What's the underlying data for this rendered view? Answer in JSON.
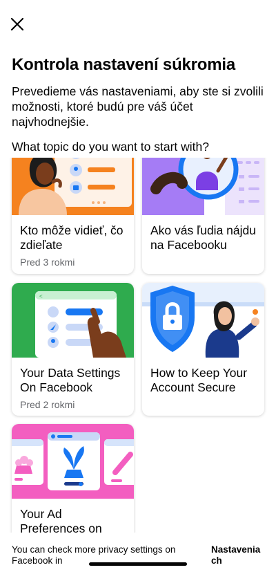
{
  "header": {
    "close_icon": "close-icon",
    "title": "Kontrola nastavení súkromia",
    "description": "Prevedieme vás nastaveniami, aby ste si zvolili možnosti, ktoré budú pre váš účet najvhodnejšie.",
    "question": "What topic do you want to start with?"
  },
  "cards": [
    {
      "title": "Kto môže vidieť, čo zdieľate",
      "meta": "Pred 3 rokmi",
      "accent": "#f5821f"
    },
    {
      "title": "Ako vás ľudia nájdu na Facebooku",
      "meta": "",
      "accent": "#a57cf5"
    },
    {
      "title": "Your Data Settings On Facebook",
      "meta": "Pred 2 rokmi",
      "accent": "#2fab4e"
    },
    {
      "title": "How to Keep Your Account Secure",
      "meta": "",
      "accent": "#1877f2"
    },
    {
      "title": "Your Ad Preferences on",
      "meta": "",
      "accent": "#f35ec0"
    }
  ],
  "footer": {
    "text": "You can check more privacy settings on Facebook in",
    "link": "Nastavenia ch"
  }
}
